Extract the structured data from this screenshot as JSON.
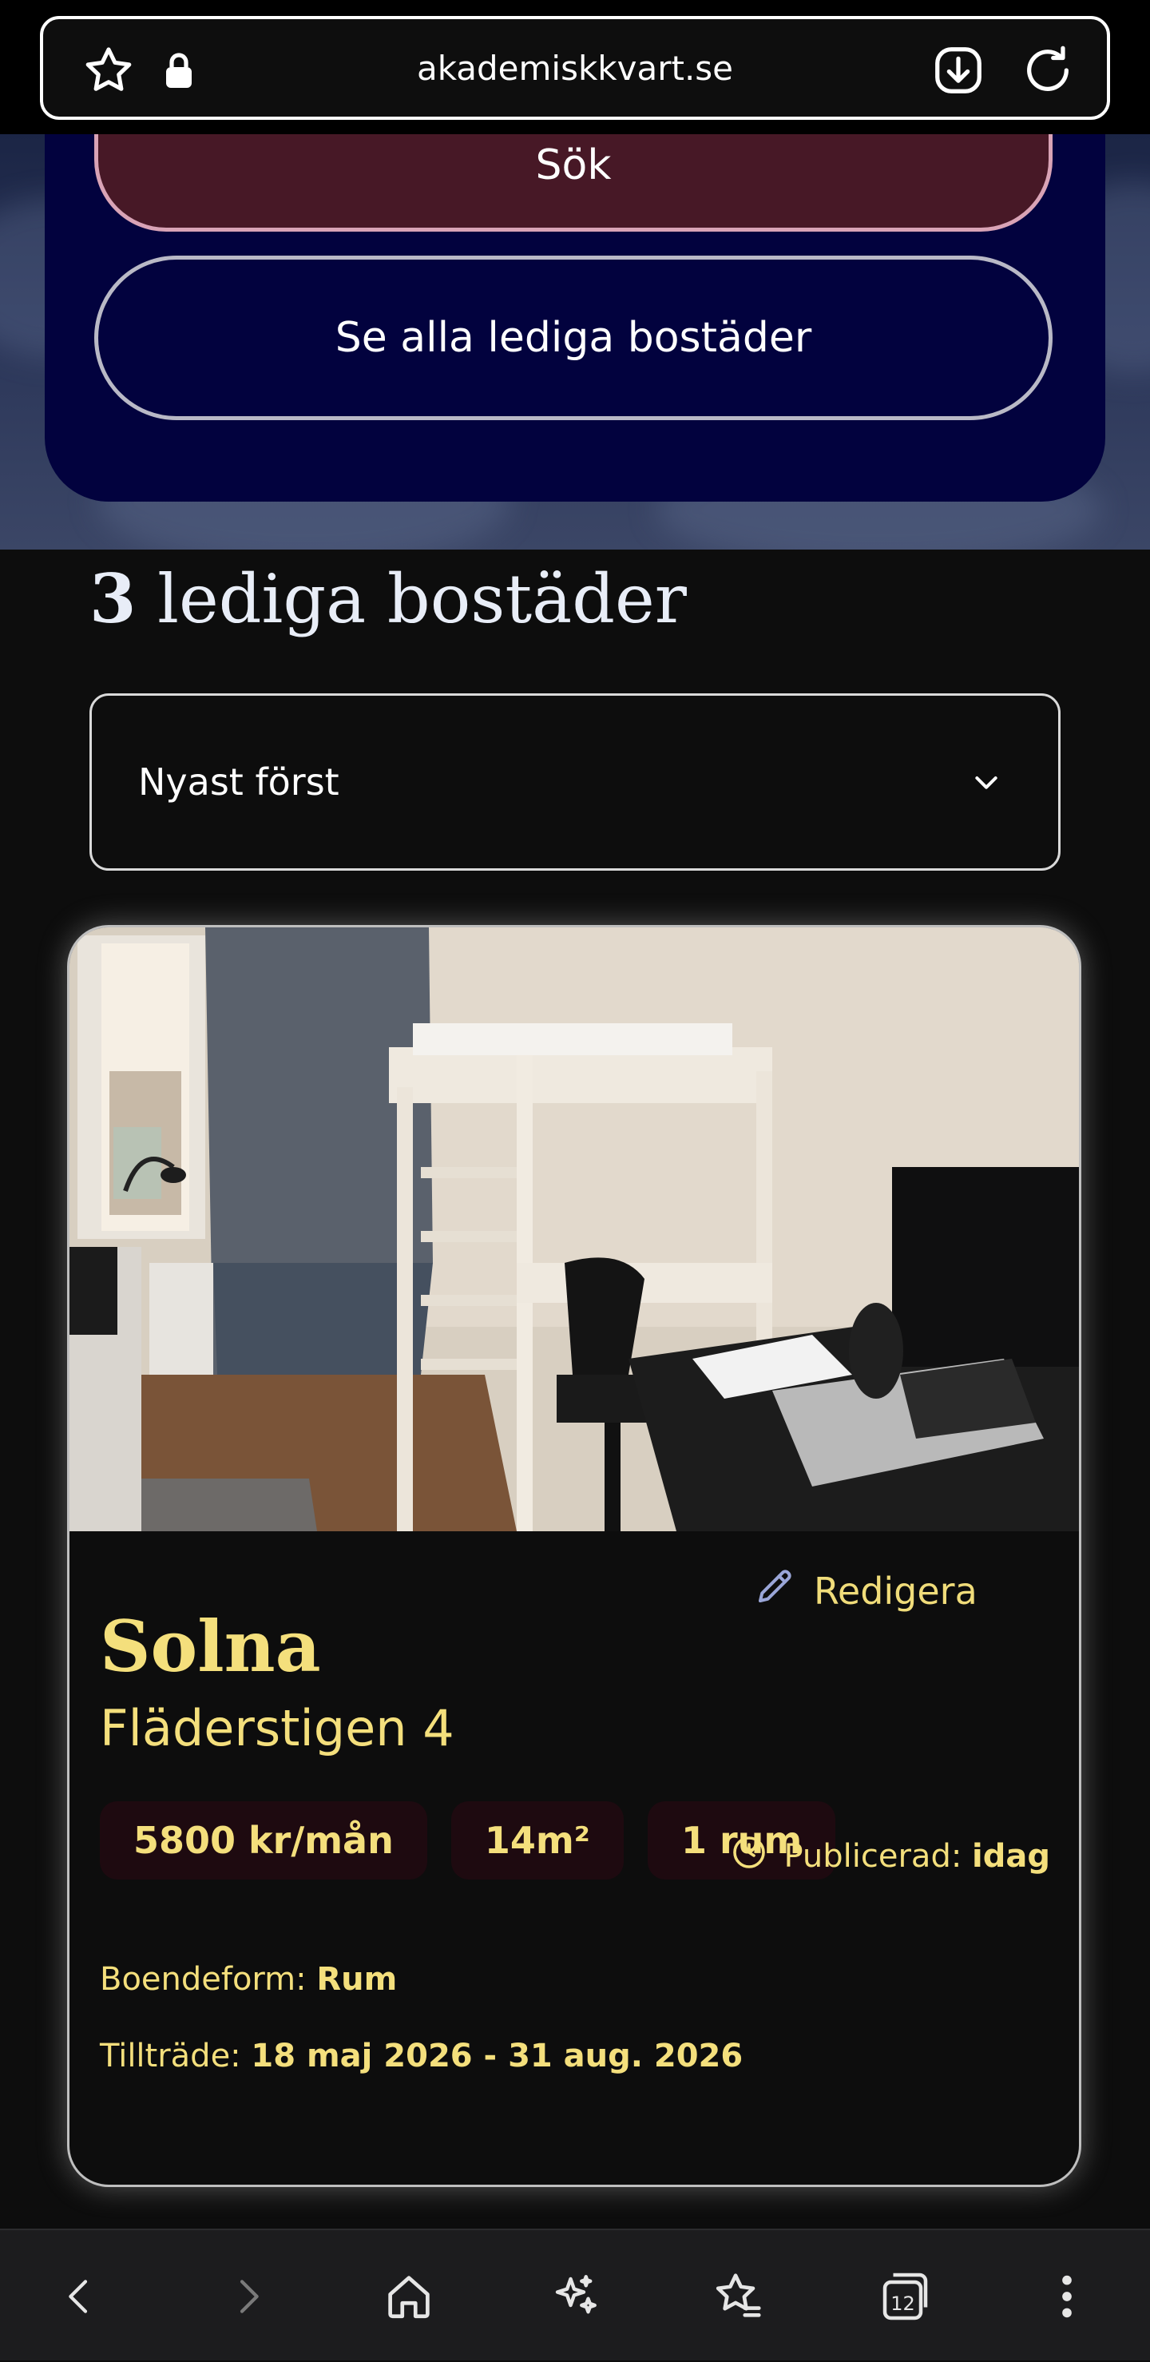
{
  "browser": {
    "url": "akademiskkvart.se",
    "tab_count": "12"
  },
  "search": {
    "search_label": "Sök",
    "see_all_label": "Se alla lediga bostäder"
  },
  "results": {
    "count": "3",
    "title_suffix": "lediga bostäder",
    "sort_selected": "Nyast först"
  },
  "listing": {
    "edit_label": "Redigera",
    "city": "Solna",
    "street": "Fläderstigen 4",
    "rent": "5800 kr/mån",
    "size": "14m²",
    "rooms": "1 rum",
    "housing_type_label": "Boendeform:",
    "housing_type_value": "Rum",
    "access_label": "Tillträde:",
    "access_value": "18 maj 2026 - 31 aug. 2026",
    "published_label": "Publicerad:",
    "published_value": "idag"
  },
  "icons": {
    "star": "star-icon",
    "lock": "lock-icon",
    "download": "download-icon",
    "reload": "reload-icon",
    "chevron": "chevron-down-icon",
    "pencil": "pencil-icon",
    "clock": "clock-icon",
    "back": "back-icon",
    "forward": "forward-icon",
    "home": "home-icon",
    "sparkle": "sparkle-icon",
    "bookmarks": "bookmarks-icon",
    "tabs": "tabs-icon",
    "menu": "more-icon"
  },
  "colors": {
    "accent_yellow": "#f4df7c",
    "panel_navy": "#02023e",
    "search_button": "#471826"
  }
}
